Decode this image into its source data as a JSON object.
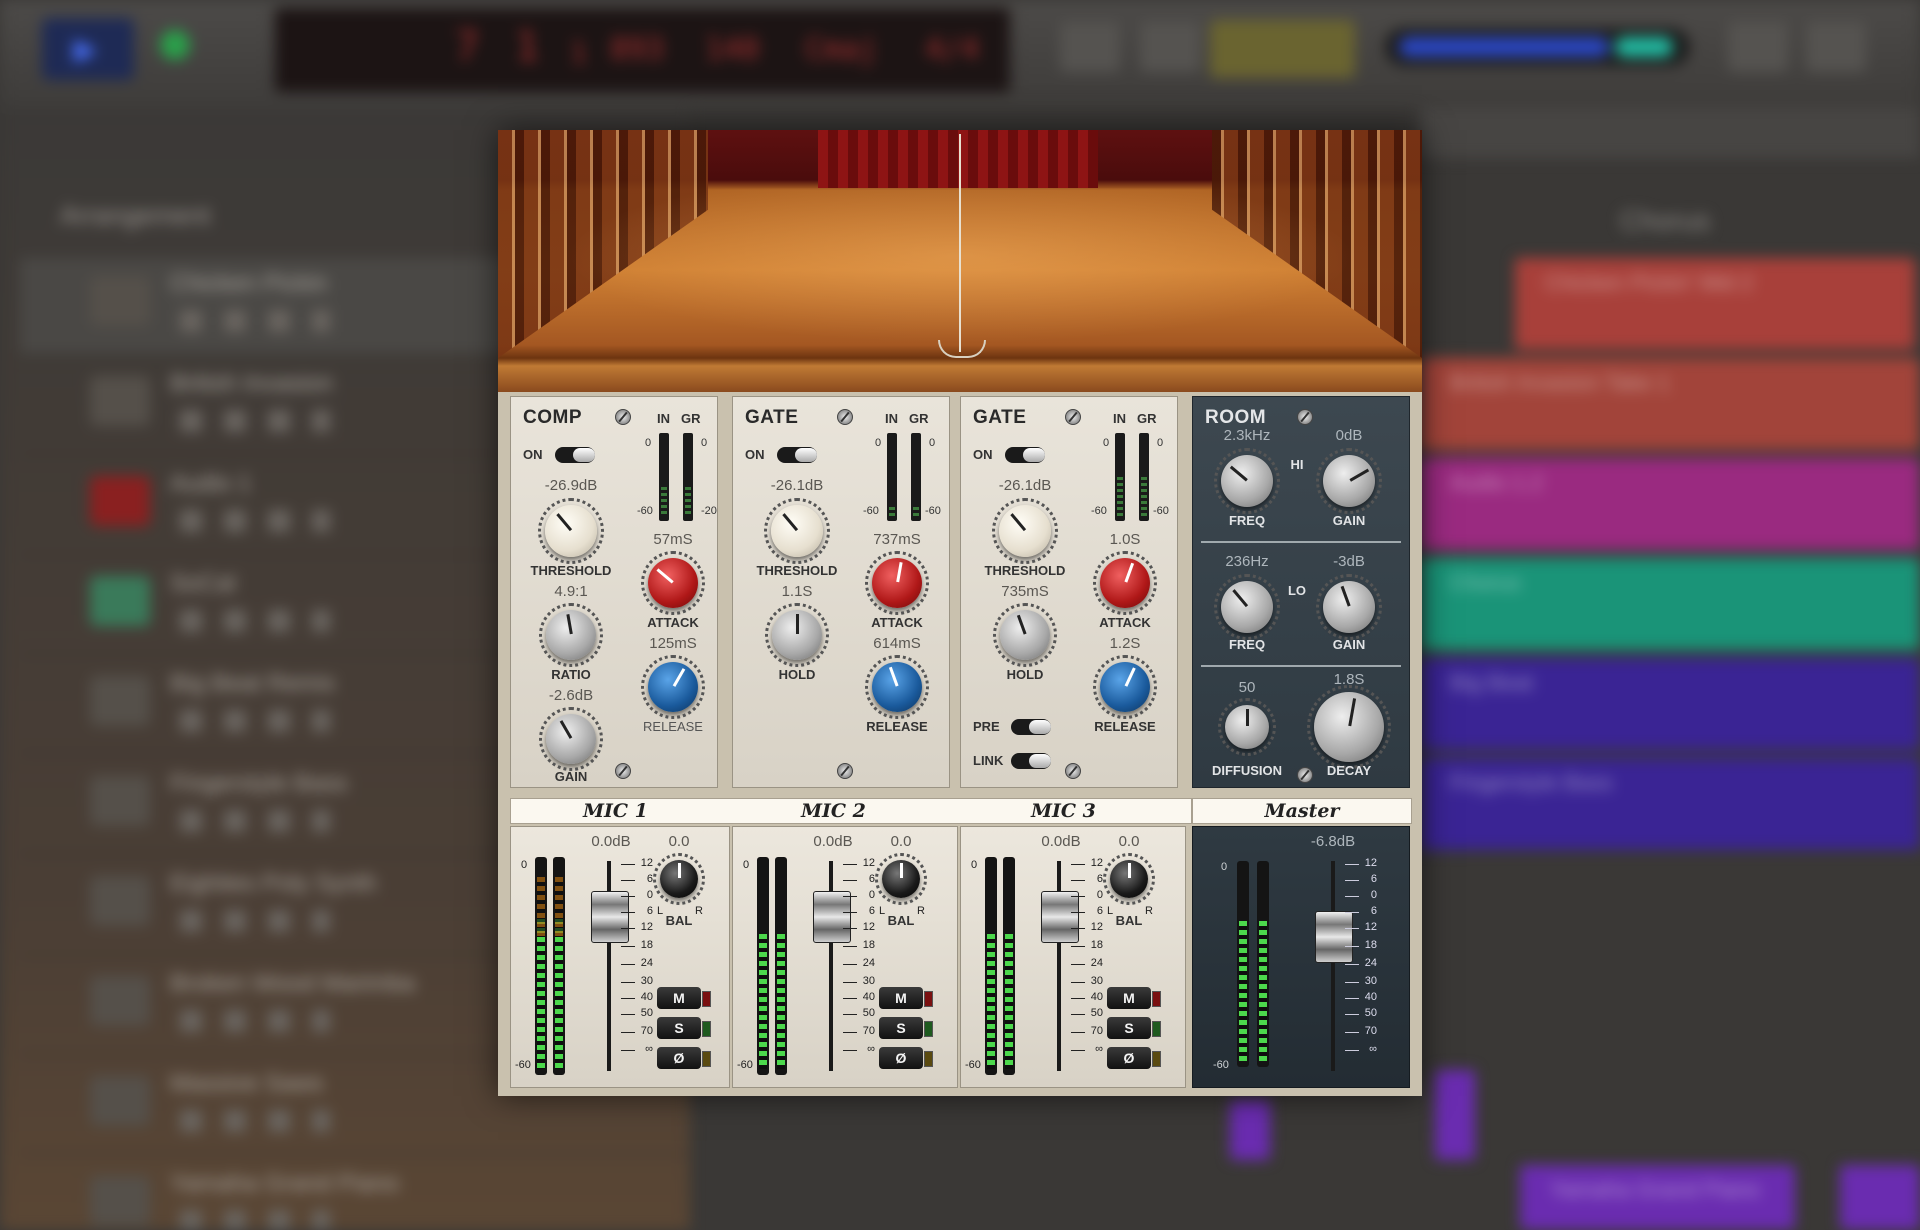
{
  "toolbar": {
    "lcd": {
      "v1": "7",
      "v2": "1",
      "v3": "1",
      "v4": "893",
      "v5": "140",
      "v6": "Cmaj",
      "v7": "4/4"
    }
  },
  "tracklist": {
    "heading": "Arrangement",
    "tracks": [
      {
        "name": "Chicken Pickin"
      },
      {
        "name": "British Invasion"
      },
      {
        "name": "Audio 1"
      },
      {
        "name": "SoCal"
      },
      {
        "name": "Big Beat Remix"
      },
      {
        "name": "Fingerstyle Bass"
      },
      {
        "name": "Eighties Poly Synth"
      },
      {
        "name": "Broken Wood Marimba"
      },
      {
        "name": "Massive Saws"
      },
      {
        "name": "Yamaha Grand Piano"
      }
    ]
  },
  "timeline": {
    "section": "Chorus",
    "regions": {
      "r1": "Chicken Pickin' Mid 2",
      "r2": "British Invasion Take 1",
      "r3": "Audio 1.2",
      "r4": "Chorus",
      "r5": "Big Beat",
      "r6": "Fingerstyle Bass",
      "r7": "Yamaha Grand Piano"
    },
    "colors": {
      "red": "#a8403a",
      "pink": "#9a2a80",
      "teal": "#1a9478",
      "purple": "#3a2494",
      "violet": "#6a2cb0"
    }
  },
  "plugin": {
    "comp": {
      "title": "COMP",
      "on": "ON",
      "in": "IN",
      "gr": "GR",
      "m_top": "0",
      "m_bot_in": "-60",
      "m_bot_gr": "-20",
      "threshold": {
        "label": "THRESHOLD",
        "value": "-26.9dB"
      },
      "ratio": {
        "label": "RATIO",
        "value": "4.9:1"
      },
      "gain": {
        "label": "GAIN",
        "value": "-2.6dB"
      },
      "attack": {
        "label": "ATTACK",
        "value": "57mS"
      },
      "release": {
        "label": "RELEASE",
        "value": "125mS"
      }
    },
    "gate1": {
      "title": "GATE",
      "on": "ON",
      "in": "IN",
      "gr": "GR",
      "m_top": "0",
      "m_bot_in": "-60",
      "m_bot_gr": "-60",
      "threshold": {
        "label": "THRESHOLD",
        "value": "-26.1dB"
      },
      "hold": {
        "label": "HOLD",
        "value": "1.1S"
      },
      "attack": {
        "label": "ATTACK",
        "value": "737mS"
      },
      "release": {
        "label": "RELEASE",
        "value": "614mS"
      }
    },
    "gate2": {
      "title": "GATE",
      "on": "ON",
      "in": "IN",
      "gr": "GR",
      "m_top": "0",
      "m_bot_in": "-60",
      "m_bot_gr": "-60",
      "threshold": {
        "label": "THRESHOLD",
        "value": "-26.1dB"
      },
      "hold": {
        "label": "HOLD",
        "value": "735mS"
      },
      "attack": {
        "label": "ATTACK",
        "value": "1.0S"
      },
      "release": {
        "label": "RELEASE",
        "value": "1.2S"
      },
      "pre": "PRE",
      "link": "LINK"
    },
    "room": {
      "title": "ROOM",
      "hi": "HI",
      "lo": "LO",
      "hi_freq": {
        "label": "FREQ",
        "value": "2.3kHz"
      },
      "hi_gain": {
        "label": "GAIN",
        "value": "0dB"
      },
      "lo_freq": {
        "label": "FREQ",
        "value": "236Hz"
      },
      "lo_gain": {
        "label": "GAIN",
        "value": "-3dB"
      },
      "diffusion": {
        "label": "DIFFUSION",
        "value": "50"
      },
      "decay": {
        "label": "DECAY",
        "value": "1.8S"
      }
    },
    "channels": [
      {
        "name": "MIC 1",
        "level": "0.0dB",
        "bal": "0.0",
        "bal_label": "BAL",
        "l": "L",
        "r": "R",
        "mute": "M",
        "solo": "S",
        "phase": "Ø"
      },
      {
        "name": "MIC 2",
        "level": "0.0dB",
        "bal": "0.0",
        "bal_label": "BAL",
        "l": "L",
        "r": "R",
        "mute": "M",
        "solo": "S",
        "phase": "Ø"
      },
      {
        "name": "MIC 3",
        "level": "0.0dB",
        "bal": "0.0",
        "bal_label": "BAL",
        "l": "L",
        "r": "R",
        "mute": "M",
        "solo": "S",
        "phase": "Ø"
      }
    ],
    "master": {
      "name": "Master",
      "level": "-6.8dB"
    },
    "meter_scale": {
      "top": "0",
      "bottom": "-60"
    },
    "fader_scale": [
      "12",
      "6",
      "0",
      "6",
      "12",
      "18",
      "24",
      "30",
      "40",
      "50",
      "70",
      "∞"
    ]
  }
}
